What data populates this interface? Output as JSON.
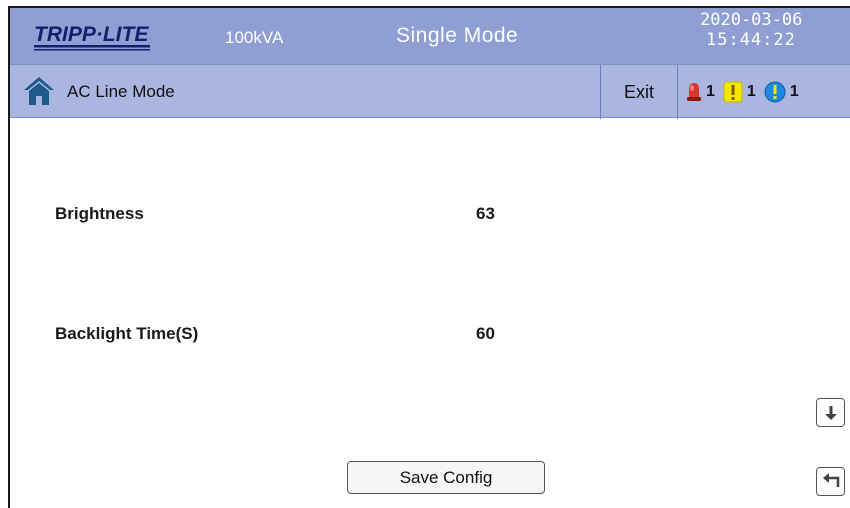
{
  "header": {
    "brand": "TRIPP·LITE",
    "capacity": "100kVA",
    "mode": "Single Mode",
    "date": "2020-03-06",
    "time": "15:44:22"
  },
  "subheader": {
    "page_title": "AC Line Mode",
    "exit_label": "Exit",
    "alarms": [
      {
        "icon": "red-alarm-beacon-icon",
        "count": "1"
      },
      {
        "icon": "yellow-warning-icon",
        "count": "1"
      },
      {
        "icon": "blue-info-icon",
        "count": "1"
      }
    ]
  },
  "settings": [
    {
      "label": "Brightness",
      "value": "63"
    },
    {
      "label": "Backlight Time(S)",
      "value": "60"
    }
  ],
  "buttons": {
    "save_label": "Save Config",
    "scroll_down_icon": "arrow-down-icon",
    "back_icon": "return-arrow-icon"
  },
  "colors": {
    "header_bg": "#8f9fd4",
    "subheader_bg": "#aab5e0",
    "alarm_red": "#d9352b",
    "warning_yellow": "#f3e600",
    "info_blue": "#1e88e5"
  }
}
